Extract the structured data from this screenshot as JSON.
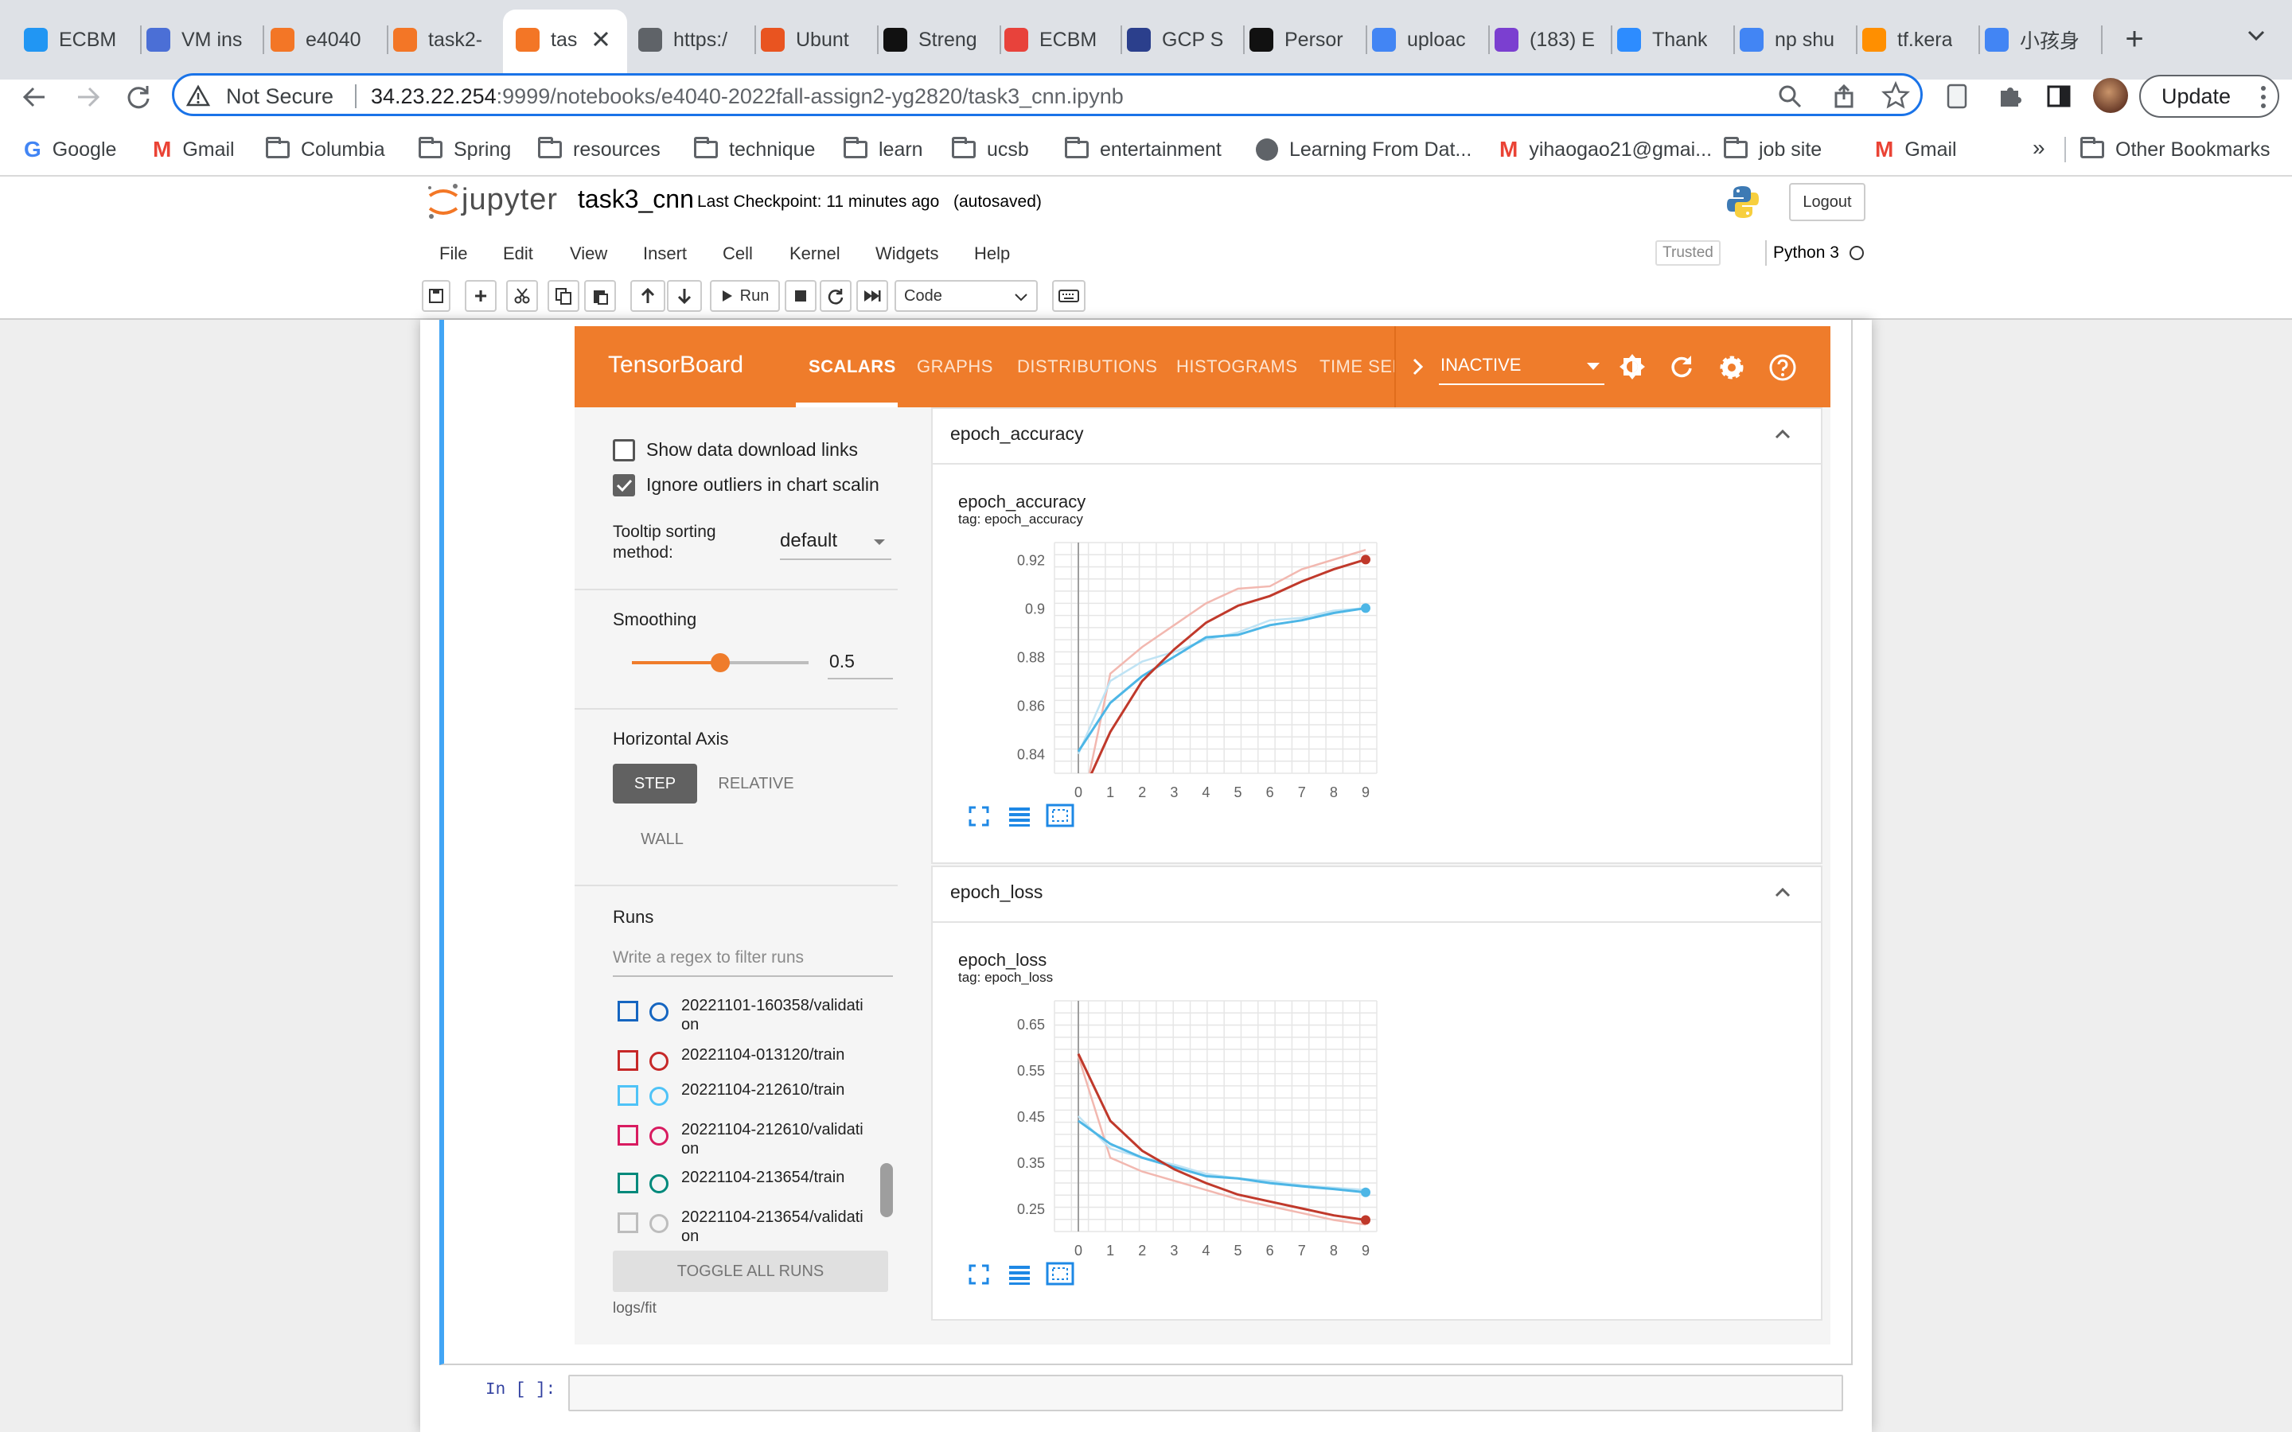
{
  "browser": {
    "tabs": [
      {
        "title": "ECBM",
        "icon": "k-logo-icon",
        "color": "#2196f3"
      },
      {
        "title": "VM ins",
        "icon": "chip-icon",
        "color": "#4b6fd6"
      },
      {
        "title": "e4040",
        "icon": "loading-ring-icon",
        "color": "#f37626"
      },
      {
        "title": "task2-",
        "icon": "notebook-icon",
        "color": "#f37626"
      },
      {
        "title": "tas",
        "icon": "notebook-icon",
        "color": "#f37626"
      },
      {
        "title": "https:/",
        "icon": "window-icon",
        "color": "#5f6368"
      },
      {
        "title": "Ubunt",
        "icon": "ubuntu-icon",
        "color": "#e95420"
      },
      {
        "title": "Streng",
        "icon": "oi-icon",
        "color": "#111111"
      },
      {
        "title": "ECBM",
        "icon": "helm-icon",
        "color": "#e8423b"
      },
      {
        "title": "GCP S",
        "icon": "raccoon-icon",
        "color": "#2b3f8c"
      },
      {
        "title": "Persor",
        "icon": "github-icon",
        "color": "#111111"
      },
      {
        "title": "uploac",
        "icon": "google-icon",
        "color": "#4285f4"
      },
      {
        "title": "(183) E",
        "icon": "ed-icon",
        "color": "#7b3fd0"
      },
      {
        "title": "Thank",
        "icon": "zoom-icon",
        "color": "#2d8cff"
      },
      {
        "title": "np shu",
        "icon": "google-icon",
        "color": "#4285f4"
      },
      {
        "title": "tf.kera",
        "icon": "tensorflow-icon",
        "color": "#ff8f00"
      },
      {
        "title": "小孩身",
        "icon": "google-icon",
        "color": "#4285f4"
      }
    ],
    "url_warning": "Not Secure",
    "url_host": "34.23.22.254",
    "url_rest": ":9999/notebooks/e4040-2022fall-assign2-yg2820/task3_cnn.ipynb",
    "update_label": "Update",
    "bookmarks": [
      "Google",
      "Gmail",
      "Columbia",
      "Spring",
      "resources",
      "technique",
      "learn",
      "ucsb",
      "entertainment",
      "Learning From Dat...",
      "yihaogao21@gmai...",
      "job site",
      "Gmail"
    ],
    "more_bookmarks": "»",
    "other_bookmarks": "Other Bookmarks"
  },
  "jupyter": {
    "logo_text": "jupyter",
    "notebook_name": "task3_cnn",
    "checkpoint": "Last Checkpoint: 11 minutes ago",
    "autosaved": "(autosaved)",
    "logout": "Logout",
    "menu": [
      "File",
      "Edit",
      "View",
      "Insert",
      "Cell",
      "Kernel",
      "Widgets",
      "Help"
    ],
    "trusted": "Trusted",
    "kernel": "Python 3",
    "run_label": "Run",
    "cell_type": "Code",
    "prompt": "In [ ]:"
  },
  "tensorboard": {
    "brand": "TensorBoard",
    "tabs": [
      "SCALARS",
      "GRAPHS",
      "DISTRIBUTIONS",
      "HISTOGRAMS",
      "TIME SER"
    ],
    "status": "INACTIVE",
    "show_download": "Show data download links",
    "ignore_outliers": "Ignore outliers in chart scalin",
    "tooltip_label_1": "Tooltip sorting",
    "tooltip_label_2": "method:",
    "tooltip_value": "default",
    "smoothing_label": "Smoothing",
    "smoothing_value": "0.5",
    "smoothing_fraction": 0.5,
    "haxis_label": "Horizontal Axis",
    "haxis_options": [
      "STEP",
      "RELATIVE",
      "WALL"
    ],
    "runs_label": "Runs",
    "runs_filter_placeholder": "Write a regex to filter runs",
    "runs": [
      {
        "line1": "20221101-160358/validati",
        "line2": "on",
        "color": "#1565c0",
        "checked": false
      },
      {
        "line1": "20221104-013120/train",
        "line2": "",
        "color": "#c62828",
        "checked": false
      },
      {
        "line1": "20221104-212610/train",
        "line2": "",
        "color": "#4fc3f7",
        "checked": false
      },
      {
        "line1": "20221104-212610/validati",
        "line2": "on",
        "color": "#d81b60",
        "checked": false
      },
      {
        "line1": "20221104-213654/train",
        "line2": "",
        "color": "#00897b",
        "checked": false
      },
      {
        "line1": "20221104-213654/validati",
        "line2": "on",
        "color": "#bdbdbd",
        "checked": false
      }
    ],
    "toggle_all": "TOGGLE ALL RUNS",
    "logdir": "logs/fit",
    "section1": "epoch_accuracy",
    "section2": "epoch_loss"
  },
  "chart_data": [
    {
      "type": "line",
      "title": "epoch_accuracy",
      "subtitle": "tag: epoch_accuracy",
      "x": [
        0,
        1,
        2,
        3,
        4,
        5,
        6,
        7,
        8,
        9
      ],
      "yticks": [
        "0.92",
        "0.9",
        "0.88",
        "0.86",
        "0.84"
      ],
      "ylim": [
        0.832,
        0.927
      ],
      "series": [
        {
          "values": [
            0.82,
            0.849,
            0.87,
            0.883,
            0.894,
            0.901,
            0.905,
            0.911,
            0.916,
            0.92
          ],
          "color": "#c0392b"
        },
        {
          "values": [
            0.841,
            0.861,
            0.872,
            0.88,
            0.888,
            0.889,
            0.893,
            0.895,
            0.898,
            0.9
          ],
          "color": "#4db6e6"
        },
        {
          "values": [
            0.81,
            0.873,
            0.884,
            0.893,
            0.902,
            0.908,
            0.909,
            0.916,
            0.92,
            0.924
          ],
          "color": "#f2b8b0"
        },
        {
          "values": [
            0.84,
            0.87,
            0.878,
            0.882,
            0.887,
            0.89,
            0.895,
            0.896,
            0.899,
            0.9
          ],
          "color": "#bfe3f4"
        }
      ]
    },
    {
      "type": "line",
      "title": "epoch_loss",
      "subtitle": "tag: epoch_loss",
      "x": [
        0,
        1,
        2,
        3,
        4,
        5,
        6,
        7,
        8,
        9
      ],
      "yticks": [
        "0.65",
        "0.55",
        "0.45",
        "0.35",
        "0.25"
      ],
      "ylim": [
        0.2,
        0.7
      ],
      "series": [
        {
          "values": [
            0.585,
            0.44,
            0.375,
            0.335,
            0.305,
            0.28,
            0.265,
            0.25,
            0.235,
            0.225
          ],
          "color": "#c0392b"
        },
        {
          "values": [
            0.44,
            0.39,
            0.36,
            0.34,
            0.32,
            0.315,
            0.305,
            0.298,
            0.292,
            0.285
          ],
          "color": "#4db6e6"
        },
        {
          "values": [
            0.58,
            0.36,
            0.33,
            0.31,
            0.29,
            0.27,
            0.255,
            0.24,
            0.225,
            0.215
          ],
          "color": "#f2b8b0"
        },
        {
          "values": [
            0.45,
            0.38,
            0.36,
            0.345,
            0.325,
            0.315,
            0.31,
            0.3,
            0.295,
            0.29
          ],
          "color": "#bfe3f4"
        }
      ]
    }
  ]
}
